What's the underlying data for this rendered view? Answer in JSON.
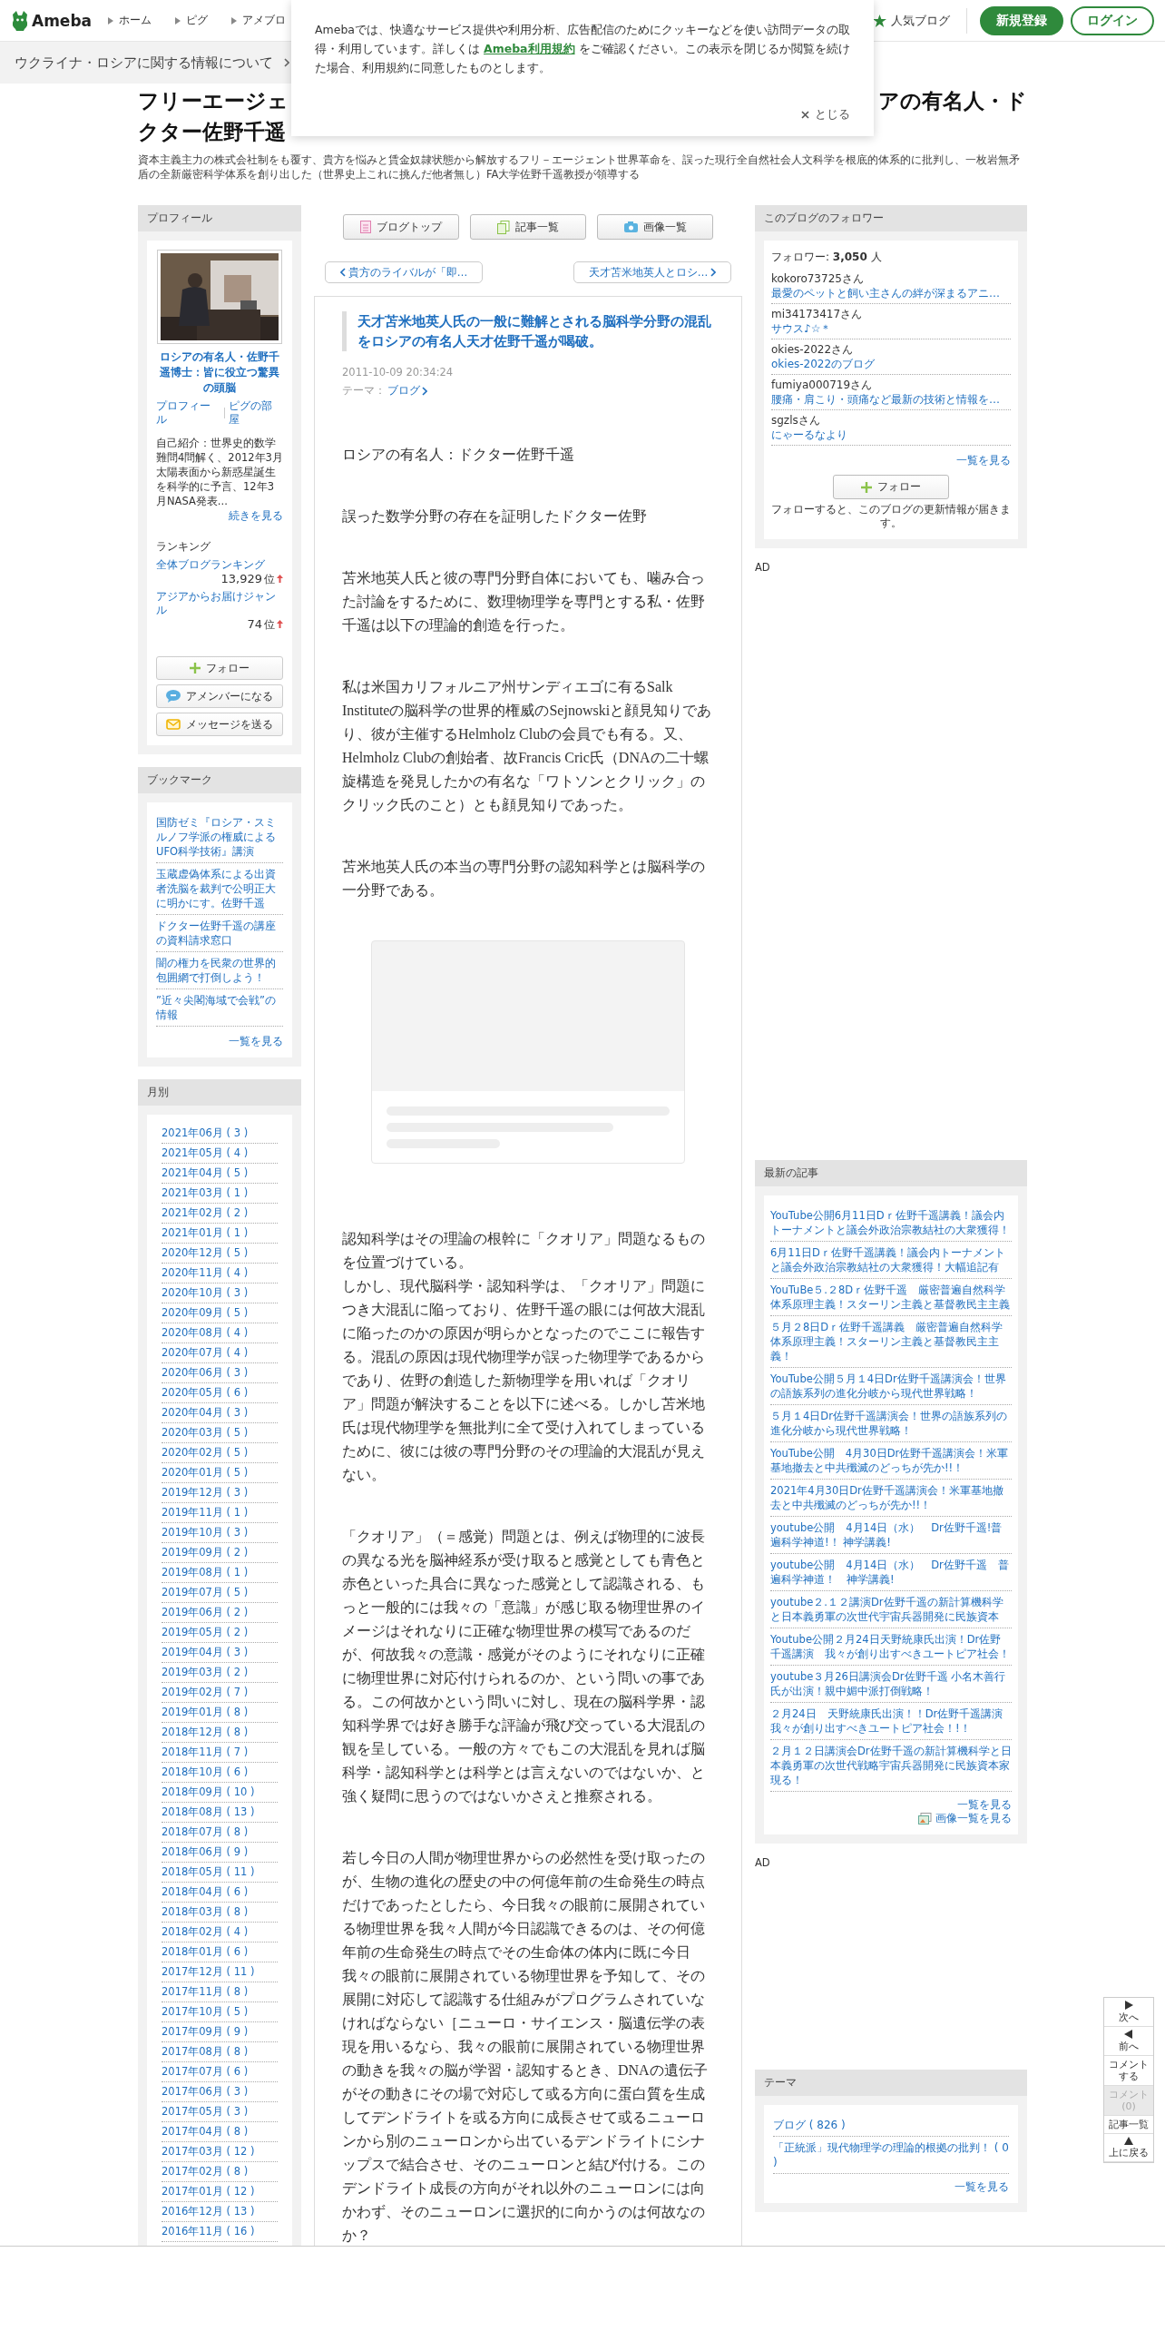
{
  "header": {
    "logo": "Ameba",
    "nav": [
      "ホーム",
      "ピグ",
      "アメブロ"
    ],
    "popular": "人気ブログ",
    "signup": "新規登録",
    "login": "ログイン"
  },
  "notice_bar": {
    "text": "ウクライナ・ロシアに関する情報について"
  },
  "cookie_dialog": {
    "text_before": "Amebaでは、快適なサービス提供や利用分析、広告配信のためにクッキーなどを使い訪問データの取得・利用しています。詳しくは",
    "link": "Ameba利用規約",
    "text_after": "をご確認ください。この表示を閉じるか閲覧を続けた場合、利用規約に同意したものとします。",
    "close": "とじる"
  },
  "blog_title": {
    "line_1_start": "フリーエージェ",
    "line_1_end": "アの有名人・ド",
    "line_2": "クター佐野千遥"
  },
  "blog_description": "資本主義主力の株式会社制をも覆す、貴方を悩みと賃金奴隷状態から解放するフリ－エージェント世界革命を、誤った現行全自然社会人文科学を根底的体系的に批判し、一枚岩無矛盾の全新厳密科学体系を創り出した（世界史上これに挑んだ他者無し）FA大学佐野千遥教授が領導する",
  "profile": {
    "heading": "プロフィール",
    "picture": {
      "kind": "picture"
    },
    "name": "ロシアの有名人・佐野千遥博士：皆に役立つ驚異の頭脳",
    "links": [
      "プロフィール",
      "ピグの部屋"
    ],
    "intro": "自己紹介：世界史的数学難問4問解く、2012年3月太陽表面から新惑星誕生を科学的に予言、12年3月NASA発表...",
    "more": "続きを見る",
    "ranking_heading": "ランキング",
    "rankings": [
      {
        "label": "全体ブログランキング",
        "rank": "13,929",
        "unit": "位"
      },
      {
        "label": "アジアからお届けジャンル",
        "rank": "74",
        "unit": "位"
      }
    ],
    "buttons": [
      {
        "kind": "follow",
        "label": "フォロー"
      },
      {
        "kind": "amember",
        "label": "アメンバーになる"
      },
      {
        "kind": "message",
        "label": "メッセージを送る"
      }
    ]
  },
  "bookmarks": {
    "heading": "ブックマーク",
    "items": [
      "国防ゼミ『ロシア・スミルノフ学派の権威によるUFO科学技術』講演",
      "玉蔵虚偽体系による出資者洗脳を裁判で公明正大に明かにす。佐野千遥",
      "ドクター佐野千遥の講座の資料請求窓口",
      "闇の権力を民衆の世界的包囲網で打倒しよう！",
      "”近々尖閣海域で会戦”の情報"
    ],
    "more": "一覧を見る"
  },
  "monthly": {
    "heading": "月別",
    "items": [
      "2021年06月 ( 3 )",
      "2021年05月 ( 4 )",
      "2021年04月 ( 5 )",
      "2021年03月 ( 1 )",
      "2021年02月 ( 2 )",
      "2021年01月 ( 1 )",
      "2020年12月 ( 5 )",
      "2020年11月 ( 4 )",
      "2020年10月 ( 3 )",
      "2020年09月 ( 5 )",
      "2020年08月 ( 4 )",
      "2020年07月 ( 4 )",
      "2020年06月 ( 3 )",
      "2020年05月 ( 6 )",
      "2020年04月 ( 3 )",
      "2020年03月 ( 5 )",
      "2020年02月 ( 5 )",
      "2020年01月 ( 5 )",
      "2019年12月 ( 3 )",
      "2019年11月 ( 1 )",
      "2019年10月 ( 3 )",
      "2019年09月 ( 2 )",
      "2019年08月 ( 1 )",
      "2019年07月 ( 5 )",
      "2019年06月 ( 2 )",
      "2019年05月 ( 2 )",
      "2019年04月 ( 3 )",
      "2019年03月 ( 2 )",
      "2019年02月 ( 7 )",
      "2019年01月 ( 8 )",
      "2018年12月 ( 8 )",
      "2018年11月 ( 7 )",
      "2018年10月 ( 6 )",
      "2018年09月 ( 10 )",
      "2018年08月 ( 13 )",
      "2018年07月 ( 8 )",
      "2018年06月 ( 9 )",
      "2018年05月 ( 11 )",
      "2018年04月 ( 6 )",
      "2018年03月 ( 8 )",
      "2018年02月 ( 4 )",
      "2018年01月 ( 6 )",
      "2017年12月 ( 11 )",
      "2017年11月 ( 8 )",
      "2017年10月 ( 5 )",
      "2017年09月 ( 9 )",
      "2017年08月 ( 8 )",
      "2017年07月 ( 6 )",
      "2017年06月 ( 3 )",
      "2017年05月 ( 3 )",
      "2017年04月 ( 8 )",
      "2017年03月 ( 12 )",
      "2017年02月 ( 8 )",
      "2017年01月 ( 12 )",
      "2016年12月 ( 13 )",
      "2016年11月 ( 16 )"
    ]
  },
  "blog_nav": [
    {
      "kind": "top",
      "label": "ブログトップ"
    },
    {
      "kind": "list",
      "label": "記事一覧"
    },
    {
      "kind": "images",
      "label": "画像一覧"
    }
  ],
  "pager": {
    "prev": "貴方のライバルが「即…",
    "next": "天才苫米地英人とロシ…"
  },
  "article": {
    "title": "天才苫米地英人氏の一般に難解とされる脳科学分野の混乱をロシアの有名人天才佐野千遥が喝破。",
    "date": "2011-10-09 20:34:24",
    "theme_label": "テーマ：",
    "theme": "ブログ",
    "blocks": [
      {
        "kind": "text",
        "text": "ロシアの有名人：ドクター佐野千遥"
      },
      {
        "kind": "text",
        "text": "誤った数学分野の存在を証明したドクター佐野"
      },
      {
        "kind": "text",
        "text": "苫米地英人氏と彼の専門分野自体においても、噛み合った討論をするために、数理物理学を専門とする私・佐野千遥は以下の理論的創造を行った。"
      },
      {
        "kind": "text",
        "text": "私は米国カリフォルニア州サンディエゴに有るSalk Instituteの脳科学の世界的権威のSejnowskiと顔見知りであり、彼が主催するHelmholz Clubの会員でも有る。又、Helmholz Clubの創始者、故Francis Cric氏（DNAの二十螺旋構造を発見したかの有名な「ワトソンとクリック」のクリック氏のこと）とも顔見知りであった。"
      },
      {
        "kind": "text",
        "text": "苫米地英人氏の本当の専門分野の認知科学とは脳科学の一分野である。"
      },
      {
        "kind": "ad"
      },
      {
        "kind": "line",
        "text": "認知科学はその理論の根幹に「クオリア」問題なるものを位置づけている。"
      },
      {
        "kind": "text",
        "text": "しかし、現代脳科学・認知科学は、「クオリア」問題につき大混乱に陥っており、佐野千遥の眼には何故大混乱に陥ったのかの原因が明らかとなったのでここに報告する。混乱の原因は現代物理学が誤った物理学であるからであり、佐野の創造した新物理学を用いれば「クオリア」問題が解決することを以下に述べる。しかし苫米地氏は現代物理学を無批判に全て受け入れてしまっているために、彼には彼の専門分野のその理論的大混乱が見えない。"
      },
      {
        "kind": "text",
        "text": "「クオリア」（＝感覚）問題とは、例えば物理的に波長の異なる光を脳神経系が受け取ると感覚としても青色と赤色といった具合に異なった感覚として認識される、もっと一般的には我々の「意識」が感じ取る物理世界のイメージはそれなりに正確な物理世界の模写であるのだが、何故我々の意識・感覚がそのようにそれなりに正確に物理世界に対応付けられるのか、という問いの事である。この何故かという問いに対し、現在の脳科学界・認知科学界では好き勝手な評論が飛び交っている大混乱の観を呈している。一般の方々でもこの大混乱を見れば脳科学・認知科学とは科学とは言えないのではないか、と強く疑問に思うのではないかさえと推察される。"
      },
      {
        "kind": "text",
        "text": "若し今日の人間が物理世界からの必然性を受け取ったのが、生物の進化の歴史の中の何億年前の生命発生の時点だけであったとしたら、今日我々の眼前に展開されている物理世界を我々人間が今日認識できるのは、その何億年前の生命発生の時点でその生命体の体内に既に今日我々の眼前に展開されている物理世界を予知して、その展開に対応して認識する仕組みがプログラムされていなければならない［ニューロ・サイエンス・脳遺伝学の表現を用いるなら、我々の眼前に展開されている物理世界の動きを我々の脳が学習・認知するとき、DNAの遺伝子がその動きにその場で対応して或る方向に蛋白質を生成してデンドライトを或る方向に成長させて或るニューロンから別のニューロンから出ているデンドライトにシナップスで結合させ、そのニューロンと結び付ける。このデンドライト成長の方向がそれ以外のニューロンには向かわず、そのニューロンに選択的に向かうのは何故なのか？"
      }
    ]
  },
  "followers": {
    "heading": "このブログのフォロワー",
    "count": "フォロワー: **3,050** 人",
    "items": [
      {
        "name": "kokoro73725さん",
        "blog": "最愛のペットと飼い主さんの絆が深まるアニ…"
      },
      {
        "name": "mi34173417さん",
        "blog": "サウス♪☆＊"
      },
      {
        "name": "okies-2022さん",
        "blog": "okies-2022のブログ"
      },
      {
        "name": "fumiya000719さん",
        "blog": "腰痛・肩こり・頭痛など最新の技術と情報を…"
      },
      {
        "name": "sgzlsさん",
        "blog": "にゃーるなより"
      }
    ],
    "more": "一覧を見る",
    "follow": "フォロー",
    "note": "フォローすると、このブログの更新情報が届きます。"
  },
  "ad_labels": [
    "AD",
    "AD"
  ],
  "recent": {
    "heading": "最新の記事",
    "items": [
      "YouTube公開6月11日Dｒ佐野千遥講義！議会内トーナメントと議会外政治宗教結社の大衆獲得！",
      "6月11日Dｒ佐野千遥講義！議会内トーナメントと議会外政治宗教結社の大衆獲得！大幅追記有",
      "YouTuBe５.２8Dｒ佐野千遥　厳密普遍自然科学体系原理主義！スターリン主義と基督教民主主義",
      "５月２8日Dｒ佐野千遥講義　厳密普遍自然科学体系原理主義！スターリン主義と基督教民主主義！",
      "YouTube公開５月１4日Dr佐野千遥講演会！世界の語族系列の進化分岐から現代世界戦略！",
      "５月１4日Dr佐野千遥講演会！世界の語族系列の進化分岐から現代世界戦略！",
      "YouTube公開　4月30日Dr佐野千遥講演会！米軍基地撤去と中共殲滅のどっちが先か!!！",
      "2021年4月30日Dr佐野千遥講演会！米軍基地撤去と中共殲滅のどっちが先か!!！",
      "youtube公開　4月14日（水）　Dr佐野千遥!普遍科学神道!！ 神学講義!",
      "youtube公開　4月14日（水）　Dr佐野千遥　普遍科学神道！　神学講義!",
      "youtube２.１２講演Dr佐野千遥の新計算機科学と日本義勇軍の次世代宇宙兵器開発に民族資本",
      "Youtube公開２月24日天野統康氏出演！Dr佐野千遥講演　我々が創り出すべきユートピア社会！",
      "youtube３月26日講演会Dr佐野千遥 小名木善行氏が出演！親中媚中派打倒戦略！",
      "２月24日　天野統康氏出演！！Dr佐野千遥講演我々が創り出すべきユートピア社会！!！",
      "２月１２日講演会Dr佐野千遥の新計算機科学と日本義勇軍の次世代戦略宇宙兵器開発に民族資本家現る！"
    ],
    "more": "一覧を見る",
    "images": "画像一覧を見る"
  },
  "themes": {
    "heading": "テーマ",
    "items": [
      "ブログ ( 826 )",
      "「正統派」現代物理学の理論的根拠の批判！ ( 0 )"
    ],
    "more": "一覧を見る"
  },
  "side_nav": [
    {
      "kind": "next",
      "label": "次へ",
      "disabled": false
    },
    {
      "kind": "prev",
      "label": "前へ",
      "disabled": false
    },
    {
      "kind": "comment",
      "label": "コメントする",
      "disabled": false
    },
    {
      "kind": "comments",
      "label": "コメント(0)",
      "disabled": true
    },
    {
      "kind": "list",
      "label": "記事一覧",
      "disabled": false
    },
    {
      "kind": "top",
      "label": "上に戻る",
      "disabled": false
    }
  ]
}
